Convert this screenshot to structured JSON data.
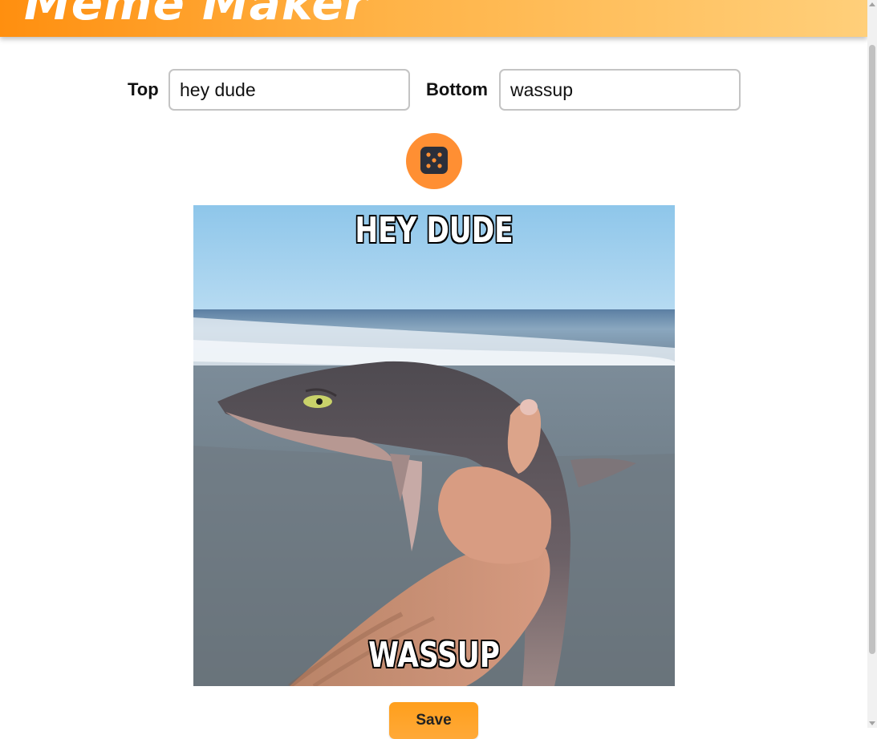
{
  "header": {
    "title": "Meme Maker"
  },
  "form": {
    "top_label": "Top",
    "top_value": "hey dude",
    "bottom_label": "Bottom",
    "bottom_value": "wassup"
  },
  "randomize": {
    "icon": "dice-icon"
  },
  "meme": {
    "top_text": "HEY DUDE",
    "bottom_text": "WASSUP",
    "image_subject": "shark-photo"
  },
  "actions": {
    "save_label": "Save"
  },
  "colors": {
    "accent": "#ff8f33",
    "header_start": "#ff8f0f",
    "header_end": "#ffcf7a"
  }
}
